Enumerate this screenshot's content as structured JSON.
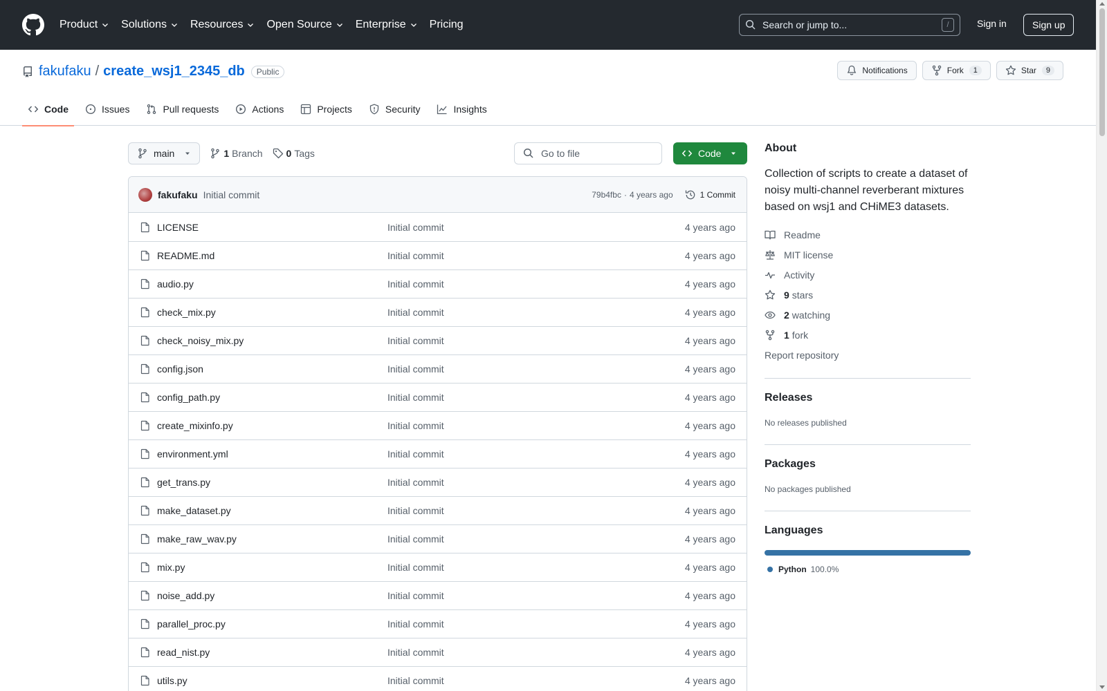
{
  "header": {
    "nav": [
      {
        "label": "Product",
        "dropdown": true
      },
      {
        "label": "Solutions",
        "dropdown": true
      },
      {
        "label": "Resources",
        "dropdown": true
      },
      {
        "label": "Open Source",
        "dropdown": true
      },
      {
        "label": "Enterprise",
        "dropdown": true
      },
      {
        "label": "Pricing",
        "dropdown": false
      }
    ],
    "search_placeholder": "Search or jump to...",
    "search_shortcut": "/",
    "sign_in": "Sign in",
    "sign_up": "Sign up"
  },
  "repo": {
    "owner": "fakufaku",
    "separator": "/",
    "name": "create_wsj1_2345_db",
    "visibility": "Public",
    "notifications_label": "Notifications",
    "fork_label": "Fork",
    "fork_count": "1",
    "star_label": "Star",
    "star_count": "9"
  },
  "tabs": [
    {
      "label": "Code",
      "icon": "code-icon",
      "active": true
    },
    {
      "label": "Issues",
      "icon": "issue-opened-icon",
      "active": false
    },
    {
      "label": "Pull requests",
      "icon": "git-pull-request-icon",
      "active": false
    },
    {
      "label": "Actions",
      "icon": "play-icon",
      "active": false
    },
    {
      "label": "Projects",
      "icon": "table-icon",
      "active": false
    },
    {
      "label": "Security",
      "icon": "shield-icon",
      "active": false
    },
    {
      "label": "Insights",
      "icon": "graph-icon",
      "active": false
    }
  ],
  "toolbar": {
    "branch": "main",
    "branch_count": "1",
    "branch_label": "Branch",
    "tag_count": "0",
    "tag_label": "Tags",
    "goto_placeholder": "Go to file",
    "code_button": "Code"
  },
  "commit": {
    "user": "fakufaku",
    "message": "Initial commit",
    "hash": "79b4fbc",
    "dot": "·",
    "time": "4 years ago",
    "count_label": "1 Commit"
  },
  "files": [
    {
      "name": "LICENSE",
      "message": "Initial commit",
      "time": "4 years ago"
    },
    {
      "name": "README.md",
      "message": "Initial commit",
      "time": "4 years ago"
    },
    {
      "name": "audio.py",
      "message": "Initial commit",
      "time": "4 years ago"
    },
    {
      "name": "check_mix.py",
      "message": "Initial commit",
      "time": "4 years ago"
    },
    {
      "name": "check_noisy_mix.py",
      "message": "Initial commit",
      "time": "4 years ago"
    },
    {
      "name": "config.json",
      "message": "Initial commit",
      "time": "4 years ago"
    },
    {
      "name": "config_path.py",
      "message": "Initial commit",
      "time": "4 years ago"
    },
    {
      "name": "create_mixinfo.py",
      "message": "Initial commit",
      "time": "4 years ago"
    },
    {
      "name": "environment.yml",
      "message": "Initial commit",
      "time": "4 years ago"
    },
    {
      "name": "get_trans.py",
      "message": "Initial commit",
      "time": "4 years ago"
    },
    {
      "name": "make_dataset.py",
      "message": "Initial commit",
      "time": "4 years ago"
    },
    {
      "name": "make_raw_wav.py",
      "message": "Initial commit",
      "time": "4 years ago"
    },
    {
      "name": "mix.py",
      "message": "Initial commit",
      "time": "4 years ago"
    },
    {
      "name": "noise_add.py",
      "message": "Initial commit",
      "time": "4 years ago"
    },
    {
      "name": "parallel_proc.py",
      "message": "Initial commit",
      "time": "4 years ago"
    },
    {
      "name": "read_nist.py",
      "message": "Initial commit",
      "time": "4 years ago"
    },
    {
      "name": "utils.py",
      "message": "Initial commit",
      "time": "4 years ago"
    }
  ],
  "about": {
    "heading": "About",
    "description": "Collection of scripts to create a dataset of noisy multi-channel reverberant mixtures based on wsj1 and CHiME3 datasets.",
    "readme": "Readme",
    "license": "MIT license",
    "activity": "Activity",
    "stars_count": "9",
    "stars_label": "stars",
    "watching_count": "2",
    "watching_label": "watching",
    "fork_count": "1",
    "fork_label": "fork",
    "report": "Report repository"
  },
  "releases": {
    "heading": "Releases",
    "empty": "No releases published"
  },
  "packages": {
    "heading": "Packages",
    "empty": "No packages published"
  },
  "languages": {
    "heading": "Languages",
    "items": [
      {
        "name": "Python",
        "percent": "100.0%",
        "fraction": 1.0,
        "color": "#3572a5"
      }
    ]
  },
  "colors": {
    "header_bg": "#24292f",
    "link": "#0969da",
    "primary_button": "#1f883d",
    "active_tab_underline": "#fd8c73"
  }
}
